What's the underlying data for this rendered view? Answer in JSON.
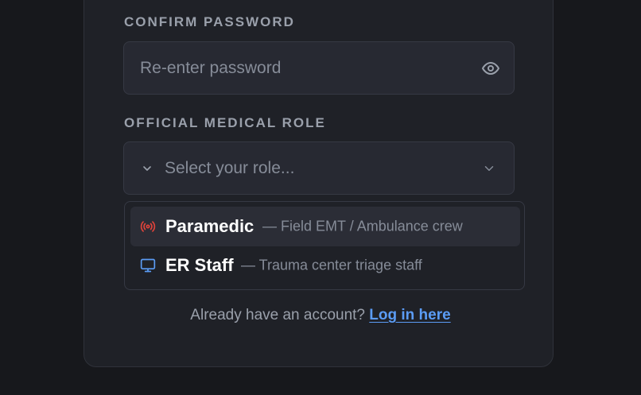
{
  "confirm_password": {
    "label": "CONFIRM PASSWORD",
    "placeholder": "Re-enter password",
    "toggle_icon": "eye-icon"
  },
  "role": {
    "label": "OFFICIAL MEDICAL ROLE",
    "placeholder": "Select your role...",
    "options": [
      {
        "title": "Paramedic",
        "description": "— Field EMT / Ambulance crew",
        "icon": "broadcast-icon",
        "icon_color": "#e0433a"
      },
      {
        "title": "ER Staff",
        "description": "— Trauma center triage staff",
        "icon": "monitor-icon",
        "icon_color": "#5b9cf5"
      }
    ]
  },
  "footer": {
    "prompt": "Already have an account?",
    "link": "Log in here"
  }
}
